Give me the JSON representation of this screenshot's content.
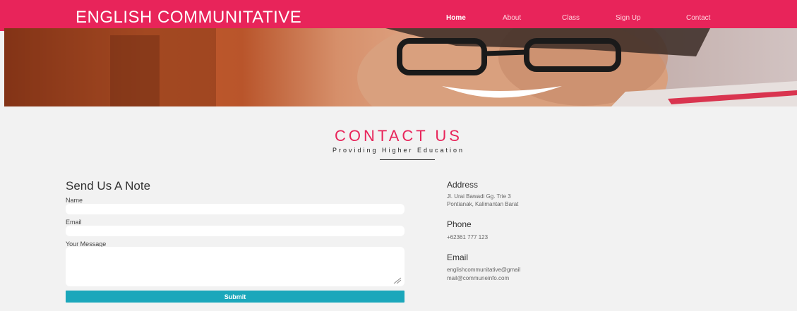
{
  "header": {
    "brand": "ENGLISH COMMUNITATIVE",
    "nav": [
      {
        "label": "Home",
        "active": true
      },
      {
        "label": "About",
        "active": false
      },
      {
        "label": "Class",
        "active": false
      },
      {
        "label": "Sign Up",
        "active": false
      },
      {
        "label": "Contact",
        "active": false
      }
    ]
  },
  "hero": {
    "icon": "hero-photo"
  },
  "section": {
    "title": "CONTACT US",
    "subtitle": "Providing Higher Education"
  },
  "form": {
    "heading": "Send Us A Note",
    "name_label": "Name",
    "name_value": "",
    "email_label": "Email",
    "email_value": "",
    "message_label": "Your Message",
    "message_value": "",
    "submit_label": "Submit"
  },
  "contact": {
    "address_heading": "Address",
    "address_line1": "Jl. Urai Bawadi Gg. Trie 3",
    "address_line2": "Pontianak, Kalimantan Barat",
    "phone_heading": "Phone",
    "phone_value": "+62361 777 123",
    "email_heading": "Email",
    "email_line1": "englishcommunitative@gmail",
    "email_line2": "mail@communeinfo.com"
  },
  "colors": {
    "accent": "#e8245a",
    "button": "#1ba7bb",
    "background": "#f2f2f2"
  }
}
